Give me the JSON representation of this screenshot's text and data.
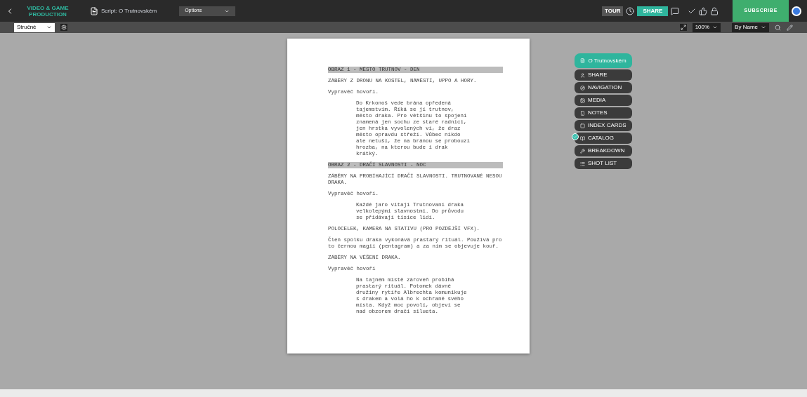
{
  "topbar": {
    "logo": "VIDEO & GAME PRODUCTION",
    "doc_title": "Script: O Trutnovském",
    "options": "Options",
    "tour": "TOUR",
    "share": "SHARE",
    "subscribe": "SUBSCRIBE"
  },
  "toolbar": {
    "format": "Stručné",
    "zoom": "100%",
    "sort": "By Name"
  },
  "script": [
    {
      "kind": "heading",
      "text": "OBRAZ 1 - MĚSTO TRUTNOV - DEN"
    },
    {
      "kind": "action",
      "text": "ZÁBĚRY Z DRONU NA KOSTEL, NÁMĚSTÍ, UPPO A HORY."
    },
    {
      "kind": "action",
      "text": "Vypravěč hovoří."
    },
    {
      "kind": "dialogue",
      "text": "Do Krkonoš vede brána opředená tajemstvím. Říká se jí trutnov, město draka. Pro většinu to spojení znamená jen sochu ze staré radnici, jen hrstka vyvolených ví, že draz město opravdu střeží. Vůbec nikdo ale netuší, že na bránou se probouzí hrozba, na kterou bude i drak krátký."
    },
    {
      "kind": "heading",
      "text": "OBRAZ 2 - DRAČÍ SLAVNOSTI - NOC"
    },
    {
      "kind": "action",
      "text": "ZÁBĚRY NA PROBÍHAJÍCÍ DRAČÍ SLAVNOSTI. TRUTNOVANÉ NESOU DRAKA."
    },
    {
      "kind": "action",
      "text": "Vypravěč hovoří."
    },
    {
      "kind": "dialogue",
      "text": "Každé jaro vítají Trutnovaní draka velkolepými slavnostmi. Do průvodu se přidávají tisíce lidí."
    },
    {
      "kind": "action",
      "text": "POLOCELEK, KAMERA NA STATIVU (PRO POZDĚJŠÍ VFX)."
    },
    {
      "kind": "action",
      "text": "Člen spolku draka vykonává prastarý rituál. Používá pro to černou magii (pentagram) a za ním se objevuje kouř."
    },
    {
      "kind": "action",
      "text": "ZÁBĚRY NA VĚŠENÍ DRAKA."
    },
    {
      "kind": "action",
      "text": "Vypravěč hovoří"
    },
    {
      "kind": "dialogue",
      "text": "Na tajném místě zároveň probíhá prastarý rituál. Potomek dávné družiny rytíře Albrechta komunikuje s drakem a volá ho k ochraně svého místa. Když moc povolí, objeví se nad obzorem dračí silueta."
    }
  ],
  "panel": {
    "title": "O Trutnovském",
    "items": [
      {
        "label": "SHARE",
        "checked": false
      },
      {
        "label": "NAVIGATION",
        "checked": false
      },
      {
        "label": "MEDIA",
        "checked": false
      },
      {
        "label": "NOTES",
        "checked": false
      },
      {
        "label": "INDEX CARDS",
        "checked": false
      },
      {
        "label": "CATALOG",
        "checked": true
      },
      {
        "label": "BREAKDOWN",
        "checked": false
      },
      {
        "label": "SHOT LIST",
        "checked": false
      }
    ]
  }
}
